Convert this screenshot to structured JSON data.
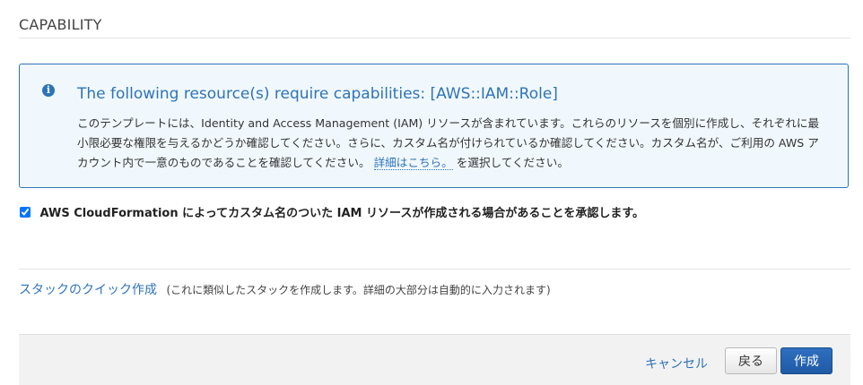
{
  "section": {
    "title": "CAPABILITY"
  },
  "info": {
    "icon": "info-icon",
    "title": "The following resource(s) require capabilities: [AWS::IAM::Role]",
    "body_before_link": "このテンプレートには、Identity and Access Management (IAM) リソースが含まれています。これらのリソースを個別に作成し、それぞれに最小限必要な権限を与えるかどうか確認してください。さらに、カスタム名が付けられているか確認してください。カスタム名が、ご利用の AWS アカウント内で一意のものであることを確認してください。",
    "link_text": "詳細はこちら。",
    "body_after_link": "を選択してください。",
    "accent_color": "#2e73b8"
  },
  "acknowledge": {
    "checked": true,
    "label": "AWS CloudFormation によってカスタム名のついた IAM リソースが作成される場合があることを承認します。"
  },
  "quick_create": {
    "link_text": "スタックのクイック作成",
    "note": "(これに類似したスタックを作成します。詳細の大部分は自動的に入力されます)"
  },
  "footer": {
    "cancel_label": "キャンセル",
    "back_label": "戻る",
    "create_label": "作成"
  }
}
